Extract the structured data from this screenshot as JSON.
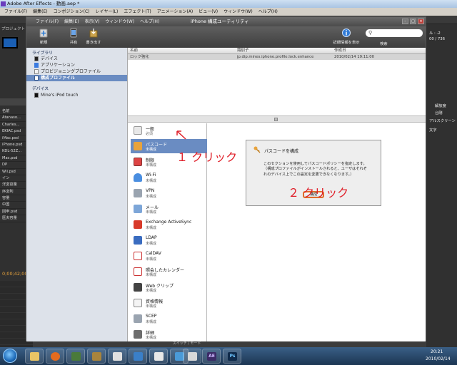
{
  "ae": {
    "title": "Adobe After Effects - 動画.aep *",
    "menu": [
      "ファイル(F)",
      "編集(E)",
      "コンポジション(C)",
      "レイヤー(L)",
      "エフェクト(T)",
      "アニメーション(A)",
      "ビュー(V)",
      "ウィンドウ(W)",
      "ヘルプ(H)"
    ],
    "project_tab": "プロジェクト",
    "files": [
      "名前",
      "Atanaso...",
      "Charles...",
      "EKIAC.psd",
      "iMac.psd",
      "iPhone.psd",
      "KDL-52Z...",
      "Mac.psd",
      "DP",
      "Wii.psd",
      "イン",
      "洋変容量",
      "序変則",
      "容量",
      "中国",
      "回申.psd",
      "医夫容量"
    ],
    "timecode": "0;00;42;00",
    "bottom_label": "スイッチ / モード",
    "right_panel": [
      "ル : -2",
      "00 / 736",
      "解放度",
      "台剛",
      "アルスクリーン",
      "文字"
    ]
  },
  "window": {
    "title": "iPhone 構成ユーティリティ",
    "menu": [
      "ファイル(F)",
      "編集(E)",
      "表示(V)",
      "ウィンドウ(W)",
      "ヘルプ(H)"
    ],
    "toolbar": {
      "new": "新規",
      "share": "共有",
      "export": "書き出す",
      "detail": "詳細情報を表示",
      "search_label": "検索",
      "search_placeholder": ""
    }
  },
  "sidebar": {
    "library_header": "ライブラリ",
    "items": [
      "デバイス",
      "アプリケーション",
      "プロビジョニングプロファイル",
      "構成プロファイル"
    ],
    "devices_header": "デバイス",
    "devices": [
      "Mine's iPod touch"
    ]
  },
  "profile_table": {
    "headers": [
      "名前",
      "識別子",
      "作成日"
    ],
    "rows": [
      [
        "ロック強化",
        "jp.dip.mines.iphone.profile.lock.enhance",
        "2010/02/14 19:11:00"
      ]
    ]
  },
  "payloads": [
    {
      "name": "一般",
      "status": "必須"
    },
    {
      "name": "パスコード",
      "status": "未構成"
    },
    {
      "name": "制限",
      "status": "未構成"
    },
    {
      "name": "Wi-Fi",
      "status": "未構成"
    },
    {
      "name": "VPN",
      "status": "未構成"
    },
    {
      "name": "メール",
      "status": "未構成"
    },
    {
      "name": "Exchange ActiveSync",
      "status": "未構成"
    },
    {
      "name": "LDAP",
      "status": "未構成"
    },
    {
      "name": "CalDAV",
      "status": "未構成"
    },
    {
      "name": "照会したカレンダー",
      "status": "未構成"
    },
    {
      "name": "Web クリップ",
      "status": "未構成"
    },
    {
      "name": "資格情報",
      "status": "未構成"
    },
    {
      "name": "SCEP",
      "status": "未構成"
    },
    {
      "name": "詳細",
      "status": "未構成"
    }
  ],
  "configure": {
    "title": "パスコードを構成",
    "description": "このセクションを使用してパスコードポリシーを指定します。（構成プロファイルがインストールされると、ユーザはそれぞれのデバイス上でこの設定を変更できなくなります。）",
    "button": "構成"
  },
  "annotations": {
    "click1": "１ クリック",
    "click2": "２ クリック"
  },
  "taskbar": {
    "ae_label": "AE",
    "ps_label": "Ps",
    "time": "20:21",
    "date": "2010/02/14"
  }
}
